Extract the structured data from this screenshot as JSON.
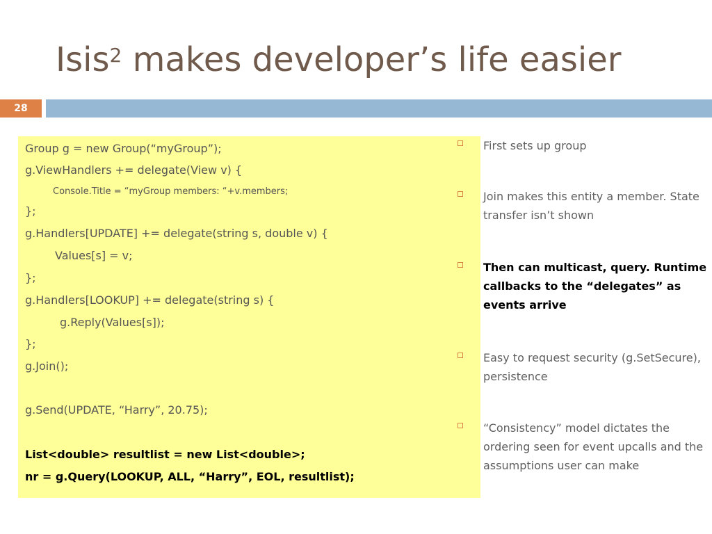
{
  "slide": {
    "title_main": "Isis",
    "title_superscript": "2",
    "title_rest": " makes developer’s life easier",
    "number": "28"
  },
  "colors": {
    "title": "#6f5a4c",
    "slide_number_bg": "#de8146",
    "header_bar": "#97b8d5",
    "code_bg": "#ffff99",
    "bullet_marker": "#de8146"
  },
  "code": {
    "lines": [
      "Group g = new Group(“myGroup”);",
      "g.ViewHandlers += delegate(View v) {",
      "Console.Title = “myGroup members: “+v.members;",
      "};",
      "g.Handlers[UPDATE] += delegate(string s, double v) {",
      "Values[s] = v;",
      "};",
      "g.Handlers[LOOKUP] += delegate(string s) {",
      "g.Reply(Values[s]);",
      "};",
      "g.Join();",
      "g.Send(UPDATE, “Harry”, 20.75);",
      "List<double> resultlist = new List<double>;",
      "nr = g.Query(LOOKUP, ALL, “Harry”, EOL, resultlist);"
    ]
  },
  "bullets": [
    "First sets up group",
    "Join makes this entity a member. State transfer isn’t shown",
    "Then can multicast, query. Runtime callbacks to the “delegates” as events arrive",
    "Easy to request security (g.SetSecure), persistence",
    "“Consistency” model dictates the ordering seen for event upcalls and the assumptions user can make"
  ]
}
